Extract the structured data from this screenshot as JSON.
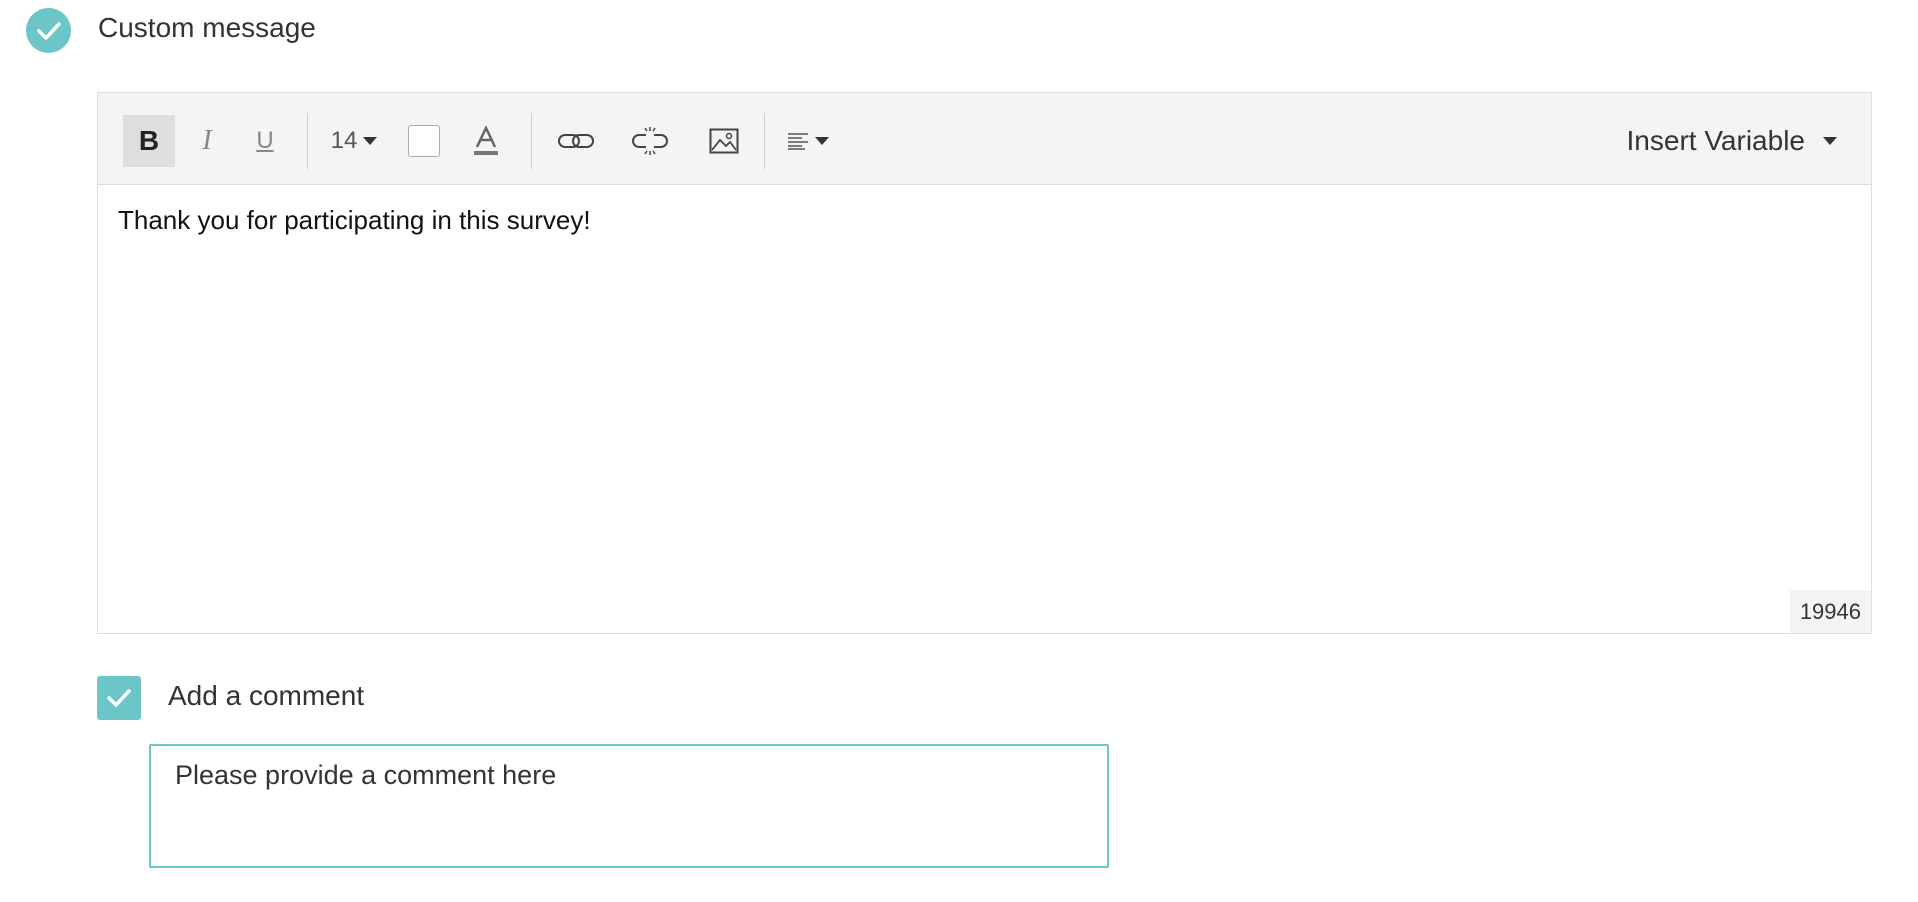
{
  "section": {
    "title": "Custom message",
    "checked": true,
    "accent_color": "#6cc5c6"
  },
  "toolbar": {
    "bold_label": "B",
    "italic_label": "I",
    "underline_label": "U",
    "font_size": "14",
    "insert_variable_label": "Insert Variable",
    "icons": [
      "bold-icon",
      "italic-icon",
      "underline-icon",
      "font-size-dropdown",
      "background-color-swatch",
      "text-color-icon",
      "link-icon",
      "unlink-icon",
      "image-icon",
      "align-left-icon"
    ]
  },
  "editor": {
    "content": "Thank you for participating in this survey!",
    "char_count": "19946"
  },
  "comment": {
    "checked": true,
    "label": "Add a comment",
    "value": "Please provide a comment here"
  }
}
